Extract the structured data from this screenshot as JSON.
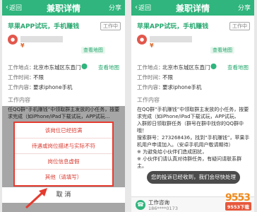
{
  "header": {
    "back_label": "返回",
    "title": "兼职详情",
    "share_label": "分享"
  },
  "job": {
    "title": "苹果APP试玩，手机赚钱",
    "tag": "工作中",
    "reward": "¥",
    "subtab_badge": "查看地图"
  },
  "details": {
    "location_label": "工作地点：",
    "location_value": "北京市东城区东直门",
    "map_link": "查看地图",
    "time_label": "工作时间：",
    "time_value": "不限",
    "content_label": "工作内容：",
    "content_value": "要求iphone手机",
    "section_title": "工作内容"
  },
  "left_body": [
    "任QQ群“手机赚钱”中领取群主发放的小任务，按要",
    "求完成（如iPhone/iPad下载试玩，APP试玩..."
  ],
  "right_body": [
    "在QQ群“手机赚钱”中领取群主发放的小任务，按要",
    "求完成（如iPhone/iPad下载试玩，APP试玩、",
    "入群即日领取群任务（群号在群中找你的QQ群中哦！",
    "搜索群号：273268436，找到“手机赚钱”，苹果手",
    "机用户申请加入。（安卓手机用户敬请期待）",
    "※ 为避免给小伙伴们造成困扰，",
    "※ 小伙伴们请认真对待群任务，有疑问请联系群主。"
  ],
  "action_sheet": {
    "items": [
      "该岗位已经招满",
      "待遇或岗位描述与实际不符",
      "岗位信息虚假",
      "其他（请填写）"
    ],
    "cancel": "取 消"
  },
  "toast": "您的投诉已经收到，我们会尽快处理",
  "bottom": {
    "label": "工作咨询",
    "number": "186****0173"
  },
  "watermark": {
    "site": "9553",
    "tag": "9553下载"
  }
}
